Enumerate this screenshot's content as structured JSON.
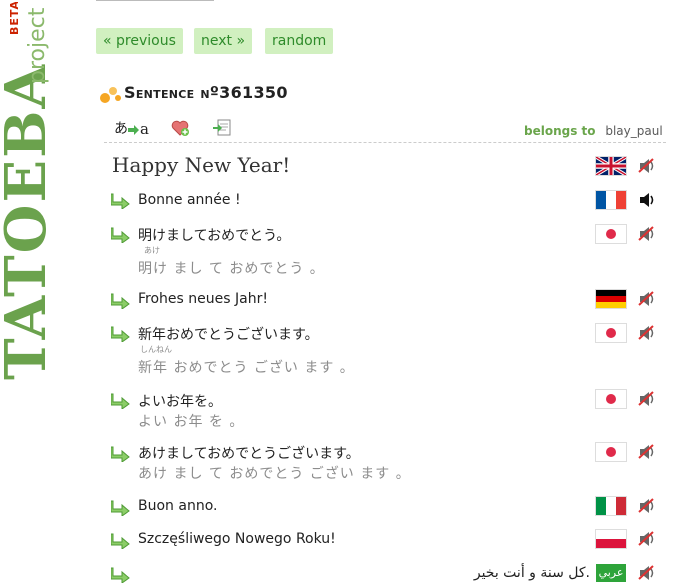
{
  "brand": {
    "beta": "BETA",
    "name": "TATOEBA",
    "suffix": "project"
  },
  "nav": {
    "previous": "« previous",
    "next": "next »",
    "random": "random"
  },
  "sentence_header": {
    "title": "Sentence nº361350"
  },
  "tools": {
    "transliterate_glyph": "あ",
    "transliterate_glyph2": "a"
  },
  "belongs": {
    "label": "belongs to",
    "user": "blay_paul"
  },
  "main_sentence": {
    "text": "Happy New Year!",
    "lang": "eng",
    "flag_icon": "uk-flag-icon",
    "audio_icon": "speaker-muted-icon"
  },
  "translations": [
    {
      "text": "Bonne année !",
      "lang": "fra",
      "flag_icon": "france-flag-icon",
      "audio": "available"
    },
    {
      "text": "明けましておめでとう。",
      "romaji": "明け まし て おめでとう 。",
      "furigana": "あけ",
      "lang": "jpn",
      "flag_icon": "japan-flag-icon",
      "audio": "muted"
    },
    {
      "text": "Frohes neues Jahr!",
      "lang": "deu",
      "flag_icon": "germany-flag-icon",
      "audio": "muted"
    },
    {
      "text": "新年おめでとうございます。",
      "romaji": "新年 おめでとう ござい ます 。",
      "furigana": "しんねん",
      "lang": "jpn",
      "flag_icon": "japan-flag-icon",
      "audio": "muted"
    },
    {
      "text": "よいお年を。",
      "romaji": "よい お年 を 。",
      "lang": "jpn",
      "flag_icon": "japan-flag-icon",
      "audio": "muted"
    },
    {
      "text": "あけましておめでとうございます。",
      "romaji": "あけ まし て おめでとう ござい ます 。",
      "lang": "jpn",
      "flag_icon": "japan-flag-icon",
      "audio": "muted"
    },
    {
      "text": "Buon anno.",
      "lang": "ita",
      "flag_icon": "italy-flag-icon",
      "audio": "muted"
    },
    {
      "text": "Szczęśliwego Nowego Roku!",
      "lang": "pol",
      "flag_icon": "poland-flag-icon",
      "audio": "muted"
    },
    {
      "text": ".كل سنة و أنت بخير",
      "lang": "ara",
      "flag_icon": "arabic-badge",
      "badge_text": "عربي",
      "audio": "muted"
    }
  ],
  "colors": {
    "brand_green": "#6ba24d",
    "nav_bg": "#d1f0c0",
    "nav_text": "#2e8b2a",
    "beta_red": "#cc2200"
  }
}
